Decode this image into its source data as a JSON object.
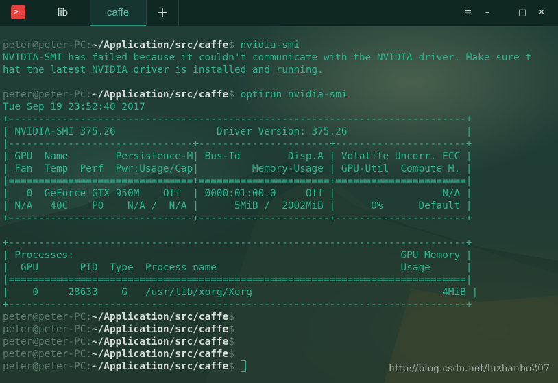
{
  "window": {
    "tabs": [
      {
        "label": "lib",
        "active": false
      },
      {
        "label": "caffe",
        "active": true
      }
    ],
    "add_tab": "+",
    "controls": {
      "menu": "≡",
      "minimize": "–",
      "maximize": "□",
      "close": "✕"
    }
  },
  "terminal": {
    "prompt": {
      "user": "peter@peter-PC",
      "sep": ":",
      "path": "~/Application/src/caffe",
      "symbol": "$"
    },
    "lines": [
      {
        "type": "prompt",
        "cmd": " nvidia-smi"
      },
      {
        "type": "out",
        "text": "NVIDIA-SMI has failed because it couldn't communicate with the NVIDIA driver. Make sure t"
      },
      {
        "type": "out",
        "text": "hat the latest NVIDIA driver is installed and running."
      },
      {
        "type": "out",
        "text": ""
      },
      {
        "type": "prompt",
        "cmd": " optirun nvidia-smi"
      },
      {
        "type": "out",
        "text": "Tue Sep 19 23:52:40 2017"
      },
      {
        "type": "out",
        "text": "+-----------------------------------------------------------------------------+"
      },
      {
        "type": "out",
        "text": "| NVIDIA-SMI 375.26                 Driver Version: 375.26                    |"
      },
      {
        "type": "out",
        "text": "|-------------------------------+----------------------+----------------------+"
      },
      {
        "type": "out",
        "text": "| GPU  Name        Persistence-M| Bus-Id        Disp.A | Volatile Uncorr. ECC |"
      },
      {
        "type": "out",
        "text": "| Fan  Temp  Perf  Pwr:Usage/Cap|         Memory-Usage | GPU-Util  Compute M. |"
      },
      {
        "type": "out",
        "text": "|===============================+======================+======================|"
      },
      {
        "type": "out",
        "text": "|   0  GeForce GTX 950M    Off  | 0000:01:00.0     Off |                  N/A |"
      },
      {
        "type": "out",
        "text": "| N/A   40C    P0    N/A /  N/A |      5MiB /  2002MiB |      0%      Default |"
      },
      {
        "type": "out",
        "text": "+-------------------------------+----------------------+----------------------+"
      },
      {
        "type": "out",
        "text": ""
      },
      {
        "type": "out",
        "text": "+-----------------------------------------------------------------------------+"
      },
      {
        "type": "out",
        "text": "| Processes:                                                       GPU Memory |"
      },
      {
        "type": "out",
        "text": "|  GPU       PID  Type  Process name                               Usage      |"
      },
      {
        "type": "out",
        "text": "|=============================================================================|"
      },
      {
        "type": "out",
        "text": "|    0     28633    G   /usr/lib/xorg/Xorg                                4MiB |"
      },
      {
        "type": "out",
        "text": "+-----------------------------------------------------------------------------+"
      },
      {
        "type": "prompt",
        "cmd": ""
      },
      {
        "type": "prompt",
        "cmd": ""
      },
      {
        "type": "prompt",
        "cmd": ""
      },
      {
        "type": "prompt",
        "cmd": ""
      },
      {
        "type": "prompt",
        "cmd": " ",
        "cursor": true
      }
    ]
  },
  "watermark": "http://blog.csdn.net/luzhanbo207"
}
